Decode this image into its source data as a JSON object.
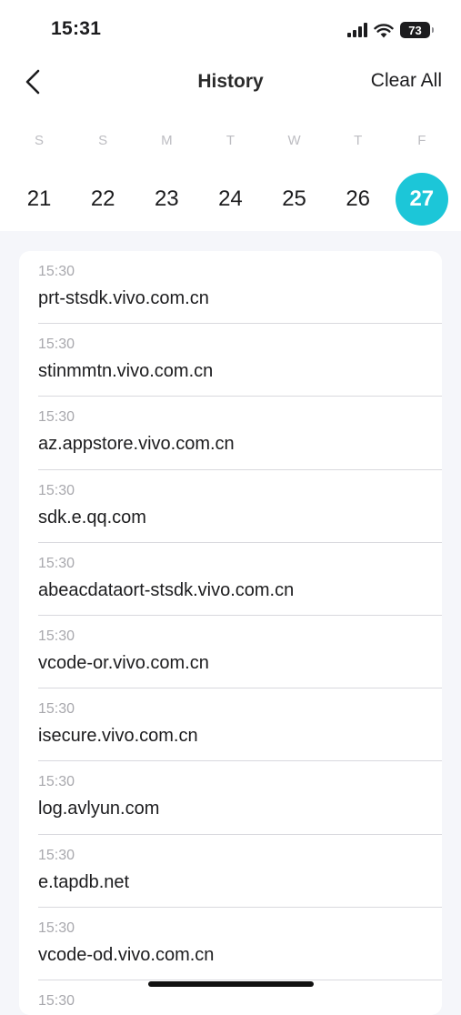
{
  "status_bar": {
    "time": "15:31",
    "battery": "73"
  },
  "header": {
    "title": "History",
    "clear_label": "Clear All"
  },
  "calendar": {
    "weekdays": [
      "S",
      "S",
      "M",
      "T",
      "W",
      "T",
      "F"
    ],
    "dates": [
      "21",
      "22",
      "23",
      "24",
      "25",
      "26",
      "27"
    ],
    "selected": "27",
    "accent_color": "#1cc6d8"
  },
  "history": [
    {
      "time": "15:30",
      "domain": "prt-stsdk.vivo.com.cn"
    },
    {
      "time": "15:30",
      "domain": "stinmmtn.vivo.com.cn"
    },
    {
      "time": "15:30",
      "domain": "az.appstore.vivo.com.cn"
    },
    {
      "time": "15:30",
      "domain": "sdk.e.qq.com"
    },
    {
      "time": "15:30",
      "domain": "abeacdataort-stsdk.vivo.com.cn"
    },
    {
      "time": "15:30",
      "domain": "vcode-or.vivo.com.cn"
    },
    {
      "time": "15:30",
      "domain": "isecure.vivo.com.cn"
    },
    {
      "time": "15:30",
      "domain": "log.avlyun.com"
    },
    {
      "time": "15:30",
      "domain": "e.tapdb.net"
    },
    {
      "time": "15:30",
      "domain": "vcode-od.vivo.com.cn"
    },
    {
      "time": "15:30",
      "domain": ""
    }
  ]
}
